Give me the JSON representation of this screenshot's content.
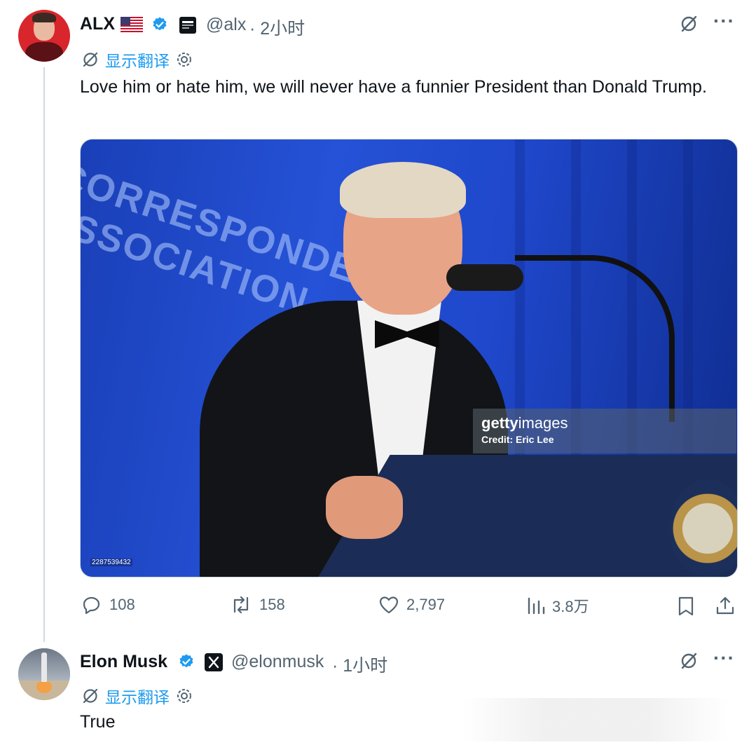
{
  "tweet1": {
    "author_name": "ALX",
    "handle": "@alx",
    "time": "· 2小时",
    "translate_label": "显示翻译",
    "text": "Love him or hate him, we will never have a funnier President than Donald Trump.",
    "media": {
      "banner_text": "CORRESPONDENTS ASSOCIATION",
      "watermark_brand_bold": "getty",
      "watermark_brand_rest": "images",
      "watermark_credit": "Credit: Eric Lee",
      "photo_id": "2287539432"
    },
    "actions": {
      "replies": "108",
      "reposts": "158",
      "likes": "2,797",
      "views": "3.8万"
    }
  },
  "tweet2": {
    "author_name": "Elon Musk",
    "handle": "@elonmusk",
    "time": "· 1小时",
    "translate_label": "显示翻译",
    "text": "True"
  },
  "icons": {
    "verified": "verified-check-icon",
    "grok": "grok-icon",
    "more": "more-icon",
    "translate": "translate-icon",
    "settings": "gear-icon",
    "reply": "reply-icon",
    "repost": "repost-icon",
    "like": "like-icon",
    "views": "views-icon",
    "bookmark": "bookmark-icon",
    "share": "share-icon"
  },
  "colors": {
    "accent": "#1d9bf0",
    "secondary_text": "#536471",
    "text": "#0f1419"
  }
}
